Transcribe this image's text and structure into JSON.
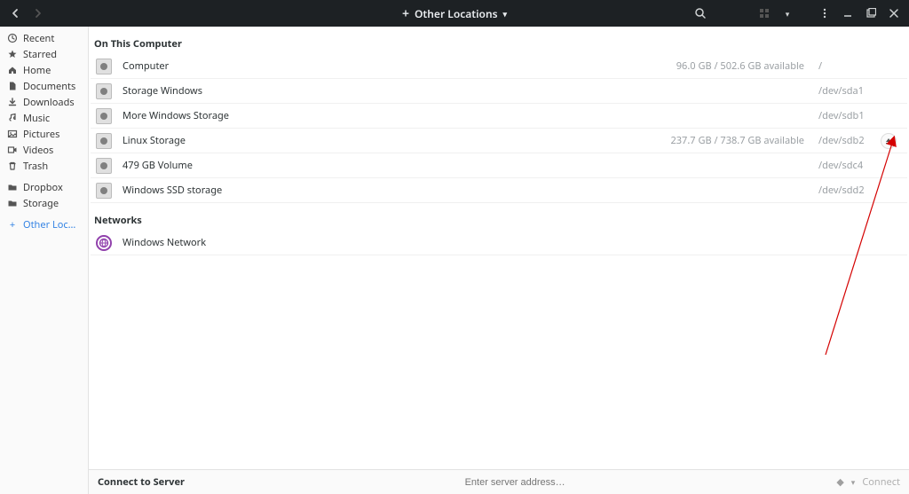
{
  "header": {
    "title": "Other Locations"
  },
  "sidebar": {
    "items": [
      {
        "icon": "clock",
        "label": "Recent"
      },
      {
        "icon": "star",
        "label": "Starred"
      },
      {
        "icon": "home",
        "label": "Home"
      },
      {
        "icon": "document",
        "label": "Documents"
      },
      {
        "icon": "download",
        "label": "Downloads"
      },
      {
        "icon": "music",
        "label": "Music"
      },
      {
        "icon": "picture",
        "label": "Pictures"
      },
      {
        "icon": "video",
        "label": "Videos"
      },
      {
        "icon": "trash",
        "label": "Trash"
      }
    ],
    "bookmarks": [
      {
        "icon": "folder",
        "label": "Dropbox"
      },
      {
        "icon": "folder",
        "label": "Storage"
      }
    ],
    "other_locations_label": "Other Locations"
  },
  "content": {
    "section1_label": "On This Computer",
    "drives": [
      {
        "name": "Computer",
        "size": "96.0 GB / 502.6 GB available",
        "mount": "/",
        "eject": false
      },
      {
        "name": "Storage Windows",
        "size": "",
        "mount": "/dev/sda1",
        "eject": false
      },
      {
        "name": "More Windows Storage",
        "size": "",
        "mount": "/dev/sdb1",
        "eject": false
      },
      {
        "name": "Linux Storage",
        "size": "237.7 GB / 738.7 GB available",
        "mount": "/dev/sdb2",
        "eject": true
      },
      {
        "name": "479 GB Volume",
        "size": "",
        "mount": "/dev/sdc4",
        "eject": false
      },
      {
        "name": "Windows SSD storage",
        "size": "",
        "mount": "/dev/sdd2",
        "eject": false
      }
    ],
    "section2_label": "Networks",
    "networks": [
      {
        "name": "Windows Network"
      }
    ]
  },
  "footer": {
    "label": "Connect to Server",
    "placeholder": "Enter server address…",
    "connect_label": "Connect"
  }
}
